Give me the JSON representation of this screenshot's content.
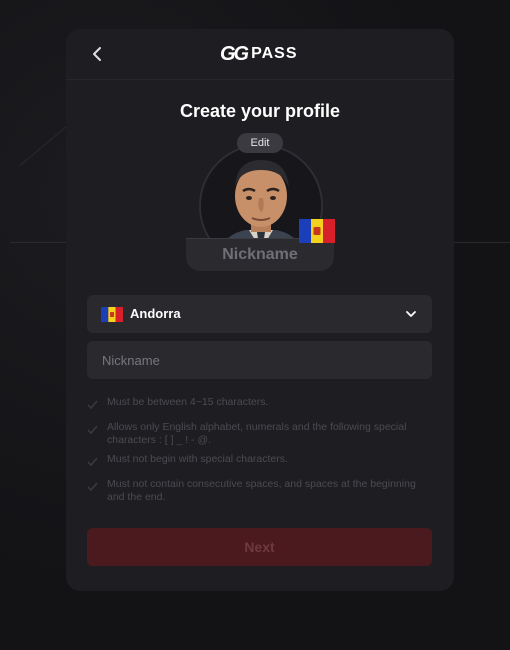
{
  "header": {
    "logo_gg": "GG",
    "logo_pass": "PASS"
  },
  "title": "Create your profile",
  "avatar": {
    "edit_label": "Edit",
    "nickname_plate": "Nickname"
  },
  "country_select": {
    "selected": "Andorra"
  },
  "nickname_field": {
    "placeholder": "Nickname",
    "value": ""
  },
  "rules": [
    "Must be between 4~15 characters.",
    "Allows only English alphabet, numerals and the following special characters : [ ] _ ! - @.",
    "Must not begin with special characters.",
    "Must not contain consecutive spaces, and spaces at the beginning and the end."
  ],
  "next_button": {
    "label": "Next"
  },
  "colors": {
    "card_bg": "#1e1e22",
    "field_bg": "#29292e",
    "next_button_bg": "#4a1a1e",
    "rule_text": "#4a4a50"
  }
}
